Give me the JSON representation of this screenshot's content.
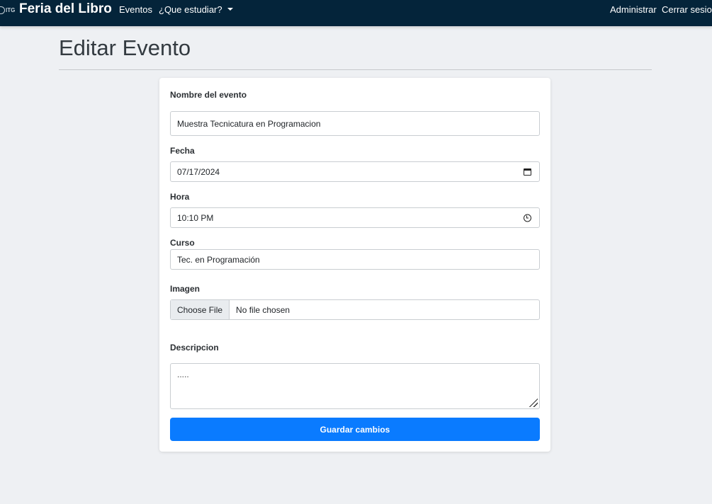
{
  "navbar": {
    "logo_text": "ITG",
    "brand": "Feria del Libro",
    "links": {
      "eventos": "Eventos",
      "estudiar": "¿Que estudiar?",
      "admin": "Administrar",
      "logout": "Cerrar sesion"
    }
  },
  "page": {
    "title": "Editar Evento"
  },
  "form": {
    "nombre": {
      "label": "Nombre del evento",
      "value": "Muestra Tecnicatura en Programacion"
    },
    "fecha": {
      "label": "Fecha",
      "value": "07/17/2024"
    },
    "hora": {
      "label": "Hora",
      "value": "10:10 PM"
    },
    "curso": {
      "label": "Curso",
      "value": "Tec. en Programación"
    },
    "imagen": {
      "label": "Imagen",
      "button": "Choose File",
      "status": "No file chosen"
    },
    "descripcion": {
      "label": "Descripcion",
      "value": "....."
    },
    "submit": "Guardar cambios"
  },
  "colors": {
    "navbar": "#04243a",
    "primary": "#0a7bff",
    "background": "#eef0f3"
  },
  "icons": {
    "fecha": "calendar-icon",
    "hora": "clock-icon"
  }
}
